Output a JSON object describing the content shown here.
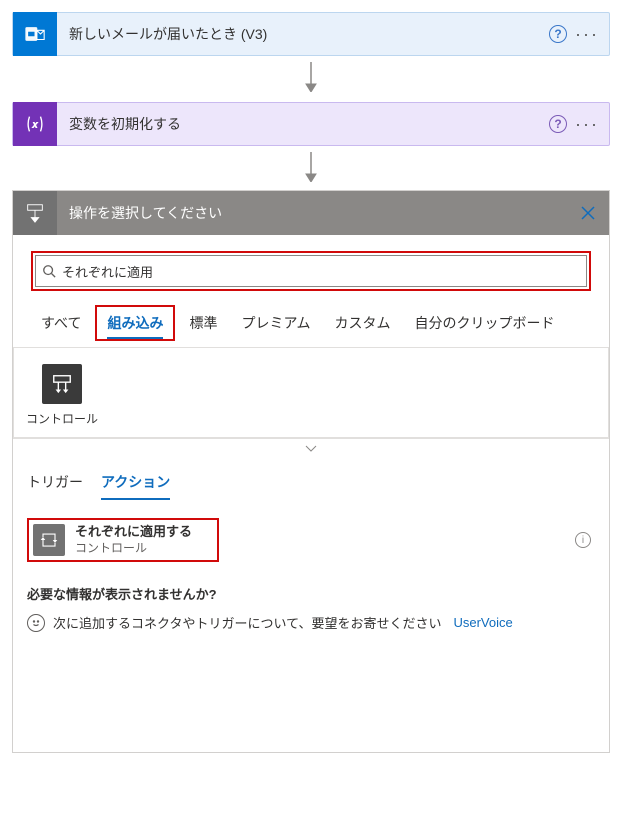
{
  "steps": {
    "trigger": {
      "title": "新しいメールが届いたとき (V3)"
    },
    "init_var": {
      "title": "変数を初期化する"
    }
  },
  "chooser": {
    "header": "操作を選択してください",
    "search": {
      "value": "それぞれに適用"
    },
    "category_tabs": {
      "all": "すべて",
      "builtin": "組み込み",
      "standard": "標準",
      "premium": "プレミアム",
      "custom": "カスタム",
      "clipboard": "自分のクリップボード"
    },
    "connectors": {
      "control": "コントロール"
    },
    "subtabs": {
      "triggers": "トリガー",
      "actions": "アクション"
    },
    "actions": {
      "apply_each": {
        "title": "それぞれに適用する",
        "subtitle": "コントロール"
      }
    },
    "missing": {
      "title": "必要な情報が表示されませんか?",
      "feedback_text": "次に追加するコネクタやトリガーについて、要望をお寄せください",
      "uservoice": "UserVoice"
    }
  }
}
